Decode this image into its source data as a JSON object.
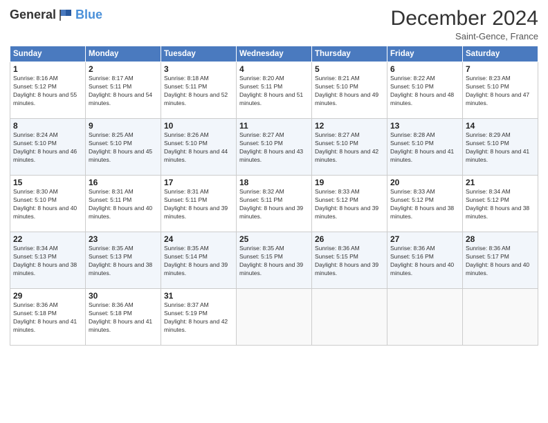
{
  "logo": {
    "general": "General",
    "blue": "Blue"
  },
  "title": "December 2024",
  "location": "Saint-Gence, France",
  "days_of_week": [
    "Sunday",
    "Monday",
    "Tuesday",
    "Wednesday",
    "Thursday",
    "Friday",
    "Saturday"
  ],
  "weeks": [
    [
      {
        "day": "1",
        "sunrise": "Sunrise: 8:16 AM",
        "sunset": "Sunset: 5:12 PM",
        "daylight": "Daylight: 8 hours and 55 minutes."
      },
      {
        "day": "2",
        "sunrise": "Sunrise: 8:17 AM",
        "sunset": "Sunset: 5:11 PM",
        "daylight": "Daylight: 8 hours and 54 minutes."
      },
      {
        "day": "3",
        "sunrise": "Sunrise: 8:18 AM",
        "sunset": "Sunset: 5:11 PM",
        "daylight": "Daylight: 8 hours and 52 minutes."
      },
      {
        "day": "4",
        "sunrise": "Sunrise: 8:20 AM",
        "sunset": "Sunset: 5:11 PM",
        "daylight": "Daylight: 8 hours and 51 minutes."
      },
      {
        "day": "5",
        "sunrise": "Sunrise: 8:21 AM",
        "sunset": "Sunset: 5:10 PM",
        "daylight": "Daylight: 8 hours and 49 minutes."
      },
      {
        "day": "6",
        "sunrise": "Sunrise: 8:22 AM",
        "sunset": "Sunset: 5:10 PM",
        "daylight": "Daylight: 8 hours and 48 minutes."
      },
      {
        "day": "7",
        "sunrise": "Sunrise: 8:23 AM",
        "sunset": "Sunset: 5:10 PM",
        "daylight": "Daylight: 8 hours and 47 minutes."
      }
    ],
    [
      {
        "day": "8",
        "sunrise": "Sunrise: 8:24 AM",
        "sunset": "Sunset: 5:10 PM",
        "daylight": "Daylight: 8 hours and 46 minutes."
      },
      {
        "day": "9",
        "sunrise": "Sunrise: 8:25 AM",
        "sunset": "Sunset: 5:10 PM",
        "daylight": "Daylight: 8 hours and 45 minutes."
      },
      {
        "day": "10",
        "sunrise": "Sunrise: 8:26 AM",
        "sunset": "Sunset: 5:10 PM",
        "daylight": "Daylight: 8 hours and 44 minutes."
      },
      {
        "day": "11",
        "sunrise": "Sunrise: 8:27 AM",
        "sunset": "Sunset: 5:10 PM",
        "daylight": "Daylight: 8 hours and 43 minutes."
      },
      {
        "day": "12",
        "sunrise": "Sunrise: 8:27 AM",
        "sunset": "Sunset: 5:10 PM",
        "daylight": "Daylight: 8 hours and 42 minutes."
      },
      {
        "day": "13",
        "sunrise": "Sunrise: 8:28 AM",
        "sunset": "Sunset: 5:10 PM",
        "daylight": "Daylight: 8 hours and 41 minutes."
      },
      {
        "day": "14",
        "sunrise": "Sunrise: 8:29 AM",
        "sunset": "Sunset: 5:10 PM",
        "daylight": "Daylight: 8 hours and 41 minutes."
      }
    ],
    [
      {
        "day": "15",
        "sunrise": "Sunrise: 8:30 AM",
        "sunset": "Sunset: 5:10 PM",
        "daylight": "Daylight: 8 hours and 40 minutes."
      },
      {
        "day": "16",
        "sunrise": "Sunrise: 8:31 AM",
        "sunset": "Sunset: 5:11 PM",
        "daylight": "Daylight: 8 hours and 40 minutes."
      },
      {
        "day": "17",
        "sunrise": "Sunrise: 8:31 AM",
        "sunset": "Sunset: 5:11 PM",
        "daylight": "Daylight: 8 hours and 39 minutes."
      },
      {
        "day": "18",
        "sunrise": "Sunrise: 8:32 AM",
        "sunset": "Sunset: 5:11 PM",
        "daylight": "Daylight: 8 hours and 39 minutes."
      },
      {
        "day": "19",
        "sunrise": "Sunrise: 8:33 AM",
        "sunset": "Sunset: 5:12 PM",
        "daylight": "Daylight: 8 hours and 39 minutes."
      },
      {
        "day": "20",
        "sunrise": "Sunrise: 8:33 AM",
        "sunset": "Sunset: 5:12 PM",
        "daylight": "Daylight: 8 hours and 38 minutes."
      },
      {
        "day": "21",
        "sunrise": "Sunrise: 8:34 AM",
        "sunset": "Sunset: 5:12 PM",
        "daylight": "Daylight: 8 hours and 38 minutes."
      }
    ],
    [
      {
        "day": "22",
        "sunrise": "Sunrise: 8:34 AM",
        "sunset": "Sunset: 5:13 PM",
        "daylight": "Daylight: 8 hours and 38 minutes."
      },
      {
        "day": "23",
        "sunrise": "Sunrise: 8:35 AM",
        "sunset": "Sunset: 5:13 PM",
        "daylight": "Daylight: 8 hours and 38 minutes."
      },
      {
        "day": "24",
        "sunrise": "Sunrise: 8:35 AM",
        "sunset": "Sunset: 5:14 PM",
        "daylight": "Daylight: 8 hours and 39 minutes."
      },
      {
        "day": "25",
        "sunrise": "Sunrise: 8:35 AM",
        "sunset": "Sunset: 5:15 PM",
        "daylight": "Daylight: 8 hours and 39 minutes."
      },
      {
        "day": "26",
        "sunrise": "Sunrise: 8:36 AM",
        "sunset": "Sunset: 5:15 PM",
        "daylight": "Daylight: 8 hours and 39 minutes."
      },
      {
        "day": "27",
        "sunrise": "Sunrise: 8:36 AM",
        "sunset": "Sunset: 5:16 PM",
        "daylight": "Daylight: 8 hours and 40 minutes."
      },
      {
        "day": "28",
        "sunrise": "Sunrise: 8:36 AM",
        "sunset": "Sunset: 5:17 PM",
        "daylight": "Daylight: 8 hours and 40 minutes."
      }
    ],
    [
      {
        "day": "29",
        "sunrise": "Sunrise: 8:36 AM",
        "sunset": "Sunset: 5:18 PM",
        "daylight": "Daylight: 8 hours and 41 minutes."
      },
      {
        "day": "30",
        "sunrise": "Sunrise: 8:36 AM",
        "sunset": "Sunset: 5:18 PM",
        "daylight": "Daylight: 8 hours and 41 minutes."
      },
      {
        "day": "31",
        "sunrise": "Sunrise: 8:37 AM",
        "sunset": "Sunset: 5:19 PM",
        "daylight": "Daylight: 8 hours and 42 minutes."
      },
      null,
      null,
      null,
      null
    ]
  ]
}
